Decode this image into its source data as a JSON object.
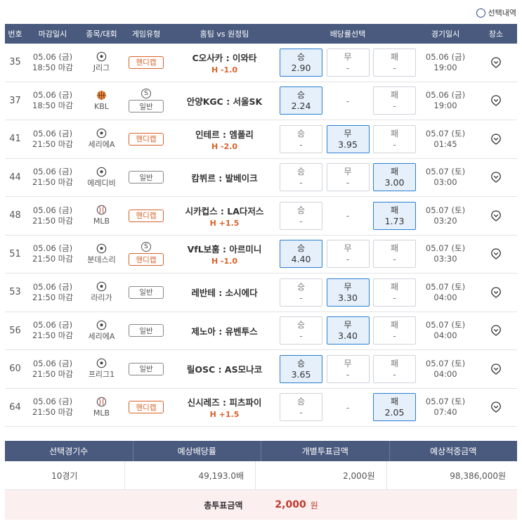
{
  "top": {
    "toggle_label": "선택내역"
  },
  "headers": [
    "번호",
    "마감일시",
    "종목/대회",
    "게임유형",
    "홈팀 vs 원정팀",
    "배당률선택",
    "경기일시",
    "장소"
  ],
  "rows": [
    {
      "num": "35",
      "date": "05.06 (금)",
      "deadline": "18:50 마감",
      "sport": "soccer",
      "league": "J리그",
      "s_badge": "",
      "type": "핸디캡",
      "type_kind": "handicap",
      "match": "C오사카 : 이와타",
      "hc": "H -1.0",
      "odds": [
        {
          "label": "승",
          "value": "2.90",
          "selected": true
        },
        {
          "label": "무",
          "value": "-",
          "selected": false
        },
        {
          "label": "패",
          "value": "-",
          "selected": false
        }
      ],
      "game_date": "05.06 (금)",
      "game_time": "19:00"
    },
    {
      "num": "37",
      "date": "05.06 (금)",
      "deadline": "18:50 마감",
      "sport": "basketball",
      "league": "KBL",
      "s_badge": "S",
      "type": "일반",
      "type_kind": "normal",
      "match": "안양KGC : 서울SK",
      "hc": "",
      "odds": [
        {
          "label": "승",
          "value": "2.24",
          "selected": true
        },
        {
          "label": "",
          "value": "-",
          "selected": false
        },
        {
          "label": "패",
          "value": "-",
          "selected": false
        }
      ],
      "game_date": "05.06 (금)",
      "game_time": "19:00"
    },
    {
      "num": "41",
      "date": "05.06 (금)",
      "deadline": "21:50 마감",
      "sport": "soccer",
      "league": "세리에A",
      "s_badge": "",
      "type": "핸디캡",
      "type_kind": "handicap",
      "match": "인테르 : 엠폴리",
      "hc": "H -2.0",
      "odds": [
        {
          "label": "승",
          "value": "-",
          "selected": false
        },
        {
          "label": "무",
          "value": "3.95",
          "selected": true
        },
        {
          "label": "패",
          "value": "-",
          "selected": false
        }
      ],
      "game_date": "05.07 (토)",
      "game_time": "01:45"
    },
    {
      "num": "44",
      "date": "05.06 (금)",
      "deadline": "21:50 마감",
      "sport": "soccer",
      "league": "에레디비",
      "s_badge": "",
      "type": "일반",
      "type_kind": "normal",
      "match": "캄뷔르 : 발베이크",
      "hc": "",
      "odds": [
        {
          "label": "승",
          "value": "-",
          "selected": false
        },
        {
          "label": "무",
          "value": "-",
          "selected": false
        },
        {
          "label": "패",
          "value": "3.00",
          "selected": true
        }
      ],
      "game_date": "05.07 (토)",
      "game_time": "03:00"
    },
    {
      "num": "48",
      "date": "05.06 (금)",
      "deadline": "21:50 마감",
      "sport": "baseball",
      "league": "MLB",
      "s_badge": "",
      "type": "핸디캡",
      "type_kind": "handicap",
      "match": "시카컵스 : LA다저스",
      "hc": "H +1.5",
      "odds": [
        {
          "label": "승",
          "value": "-",
          "selected": false
        },
        {
          "label": "",
          "value": "-",
          "selected": false
        },
        {
          "label": "패",
          "value": "1.73",
          "selected": true
        }
      ],
      "game_date": "05.07 (토)",
      "game_time": "03:20"
    },
    {
      "num": "51",
      "date": "05.06 (금)",
      "deadline": "21:50 마감",
      "sport": "soccer",
      "league": "분데스리",
      "s_badge": "S",
      "type": "핸디캡",
      "type_kind": "handicap",
      "match": "VfL보훔 : 아르미니",
      "hc": "H -1.0",
      "odds": [
        {
          "label": "승",
          "value": "4.40",
          "selected": true
        },
        {
          "label": "무",
          "value": "-",
          "selected": false
        },
        {
          "label": "패",
          "value": "-",
          "selected": false
        }
      ],
      "game_date": "05.07 (토)",
      "game_time": "03:30"
    },
    {
      "num": "53",
      "date": "05.06 (금)",
      "deadline": "21:50 마감",
      "sport": "soccer",
      "league": "라리가",
      "s_badge": "",
      "type": "일반",
      "type_kind": "normal",
      "match": "레반테 : 소시에다",
      "hc": "",
      "odds": [
        {
          "label": "승",
          "value": "-",
          "selected": false
        },
        {
          "label": "무",
          "value": "3.30",
          "selected": true
        },
        {
          "label": "패",
          "value": "-",
          "selected": false
        }
      ],
      "game_date": "05.07 (토)",
      "game_time": "04:00"
    },
    {
      "num": "56",
      "date": "05.06 (금)",
      "deadline": "21:50 마감",
      "sport": "soccer",
      "league": "세리에A",
      "s_badge": "",
      "type": "일반",
      "type_kind": "normal",
      "match": "제노아 : 유벤투스",
      "hc": "",
      "odds": [
        {
          "label": "승",
          "value": "-",
          "selected": false
        },
        {
          "label": "무",
          "value": "3.40",
          "selected": true
        },
        {
          "label": "패",
          "value": "-",
          "selected": false
        }
      ],
      "game_date": "05.07 (토)",
      "game_time": "04:00"
    },
    {
      "num": "60",
      "date": "05.06 (금)",
      "deadline": "21:50 마감",
      "sport": "soccer",
      "league": "프리그1",
      "s_badge": "",
      "type": "일반",
      "type_kind": "normal",
      "match": "릴OSC : AS모나코",
      "hc": "",
      "odds": [
        {
          "label": "승",
          "value": "3.65",
          "selected": true
        },
        {
          "label": "무",
          "value": "-",
          "selected": false
        },
        {
          "label": "패",
          "value": "-",
          "selected": false
        }
      ],
      "game_date": "05.07 (토)",
      "game_time": "04:00"
    },
    {
      "num": "64",
      "date": "05.06 (금)",
      "deadline": "21:50 마감",
      "sport": "baseball",
      "league": "MLB",
      "s_badge": "",
      "type": "핸디캡",
      "type_kind": "handicap",
      "match": "신시레즈 : 피츠파이",
      "hc": "H +1.5",
      "odds": [
        {
          "label": "승",
          "value": "-",
          "selected": false
        },
        {
          "label": "",
          "value": "-",
          "selected": false
        },
        {
          "label": "패",
          "value": "2.05",
          "selected": true
        }
      ],
      "game_date": "05.07 (토)",
      "game_time": "07:40"
    }
  ],
  "summary": {
    "headers": [
      "선택경기수",
      "예상배당률",
      "개별투표금액",
      "예상적중금액"
    ],
    "values": [
      "10경기",
      "49,193.0배",
      "2,000원",
      "98,386,000원"
    ],
    "total_label": "총투표금액",
    "total_value": "2,000",
    "total_unit": "원"
  },
  "colors": {
    "header_bg": "#4a5a7e",
    "accent_orange": "#d9612a",
    "selected_bg": "#e6f0fb",
    "selected_border": "#2b7fd1",
    "total_bg": "#fbeff0",
    "total_value": "#c0392b"
  }
}
